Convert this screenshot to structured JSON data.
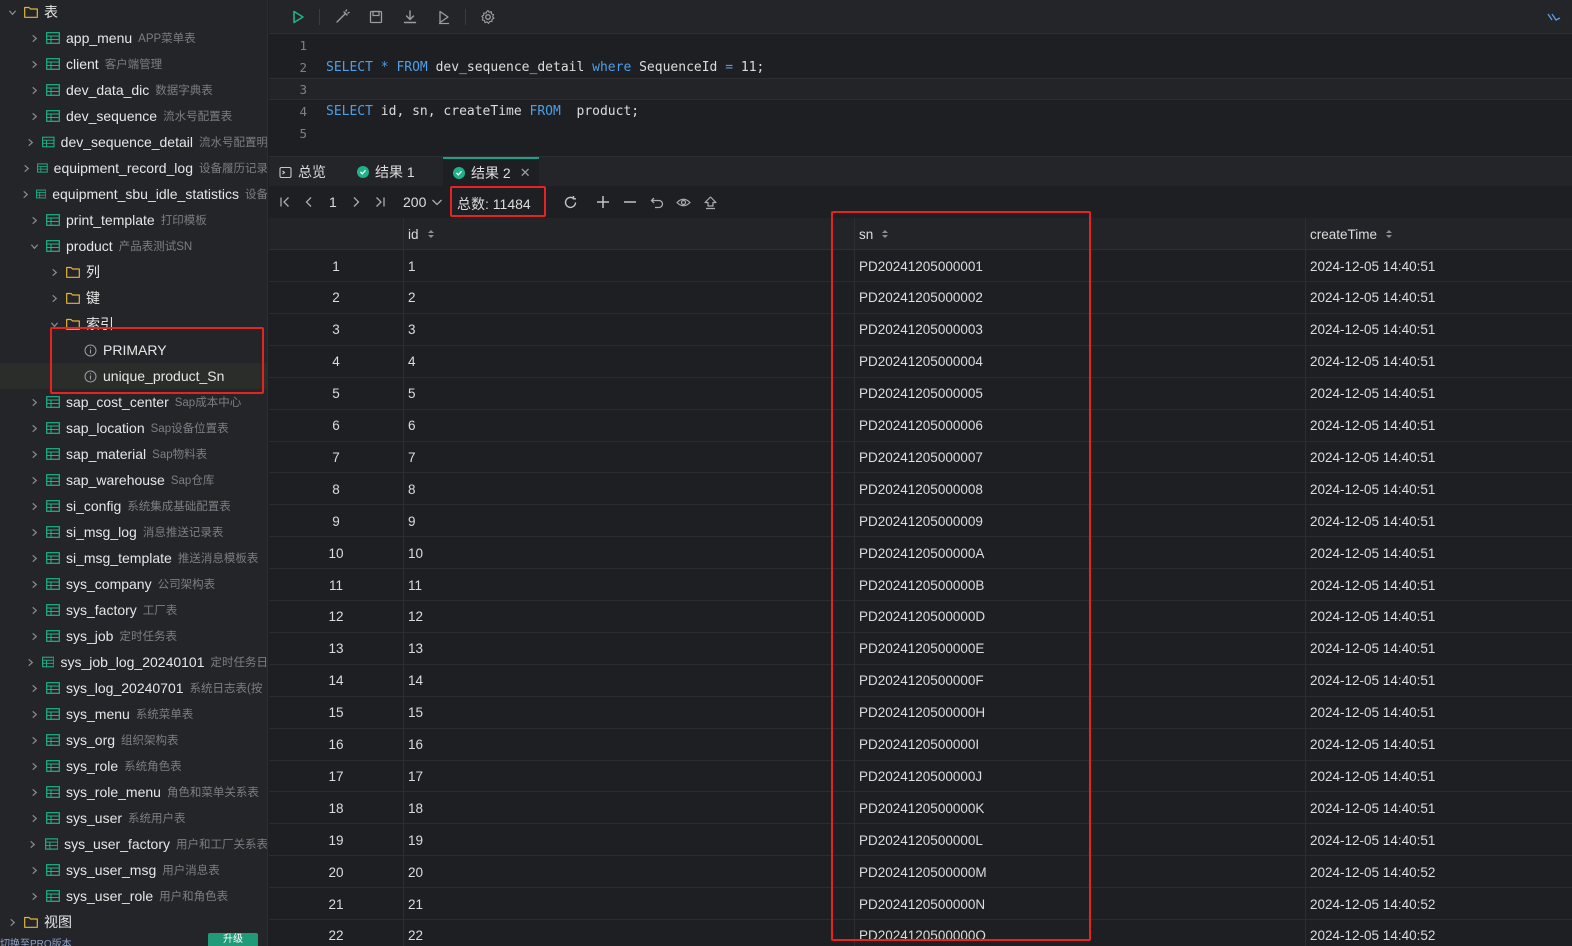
{
  "sidebar": {
    "root_label": "表",
    "tables": [
      {
        "name": "app_menu",
        "desc": "APP菜单表"
      },
      {
        "name": "client",
        "desc": "客户端管理"
      },
      {
        "name": "dev_data_dic",
        "desc": "数据字典表"
      },
      {
        "name": "dev_sequence",
        "desc": "流水号配置表"
      },
      {
        "name": "dev_sequence_detail",
        "desc": "流水号配置明"
      },
      {
        "name": "equipment_record_log",
        "desc": "设备履历记录"
      },
      {
        "name": "equipment_sbu_idle_statistics",
        "desc": "设备"
      },
      {
        "name": "print_template",
        "desc": "打印模板"
      },
      {
        "name": "product",
        "desc": "产品表测试SN"
      }
    ],
    "product_children": {
      "columns_label": "列",
      "keys_label": "键",
      "indexes_label": "索引",
      "indexes": [
        "PRIMARY",
        "unique_product_Sn"
      ]
    },
    "tables_after": [
      {
        "name": "sap_cost_center",
        "desc": "Sap成本中心"
      },
      {
        "name": "sap_location",
        "desc": "Sap设备位置表"
      },
      {
        "name": "sap_material",
        "desc": "Sap物料表"
      },
      {
        "name": "sap_warehouse",
        "desc": "Sap仓库"
      },
      {
        "name": "si_config",
        "desc": "系统集成基础配置表"
      },
      {
        "name": "si_msg_log",
        "desc": "消息推送记录表"
      },
      {
        "name": "si_msg_template",
        "desc": "推送消息模板表"
      },
      {
        "name": "sys_company",
        "desc": "公司架构表"
      },
      {
        "name": "sys_factory",
        "desc": "工厂表"
      },
      {
        "name": "sys_job",
        "desc": "定时任务表"
      },
      {
        "name": "sys_job_log_20240101",
        "desc": "定时任务日"
      },
      {
        "name": "sys_log_20240701",
        "desc": "系统日志表(按"
      },
      {
        "name": "sys_menu",
        "desc": "系统菜单表"
      },
      {
        "name": "sys_org",
        "desc": "组织架构表"
      },
      {
        "name": "sys_role",
        "desc": "系统角色表"
      },
      {
        "name": "sys_role_menu",
        "desc": "角色和菜单关系表"
      },
      {
        "name": "sys_user",
        "desc": "系统用户表"
      },
      {
        "name": "sys_user_factory",
        "desc": "用户和工厂关系表"
      },
      {
        "name": "sys_user_msg",
        "desc": "用户消息表"
      },
      {
        "name": "sys_user_role",
        "desc": "用户和角色表"
      }
    ],
    "views_label": "视图",
    "bottom_text": "切换至PRO版本",
    "bottom_button": "升级"
  },
  "editor": {
    "lines": [
      {
        "n": "1",
        "code": ""
      },
      {
        "n": "2",
        "code": "SELECT * FROM dev_sequence_detail where SequenceId = 11;"
      },
      {
        "n": "3",
        "code": ""
      },
      {
        "n": "4",
        "code": "SELECT id, sn, createTime FROM  product;"
      },
      {
        "n": "5",
        "code": ""
      }
    ]
  },
  "tabs": [
    {
      "label": "总览"
    },
    {
      "label": "结果 1"
    },
    {
      "label": "结果 2"
    }
  ],
  "pager": {
    "page": "1",
    "page_size": "200",
    "total_label": "总数:",
    "total_value": "11484"
  },
  "grid": {
    "columns": [
      "id",
      "sn",
      "createTime"
    ],
    "rows": [
      [
        "1",
        "1",
        "PD20241205000001",
        "2024-12-05 14:40:51"
      ],
      [
        "2",
        "2",
        "PD20241205000002",
        "2024-12-05 14:40:51"
      ],
      [
        "3",
        "3",
        "PD20241205000003",
        "2024-12-05 14:40:51"
      ],
      [
        "4",
        "4",
        "PD20241205000004",
        "2024-12-05 14:40:51"
      ],
      [
        "5",
        "5",
        "PD20241205000005",
        "2024-12-05 14:40:51"
      ],
      [
        "6",
        "6",
        "PD20241205000006",
        "2024-12-05 14:40:51"
      ],
      [
        "7",
        "7",
        "PD20241205000007",
        "2024-12-05 14:40:51"
      ],
      [
        "8",
        "8",
        "PD20241205000008",
        "2024-12-05 14:40:51"
      ],
      [
        "9",
        "9",
        "PD20241205000009",
        "2024-12-05 14:40:51"
      ],
      [
        "10",
        "10",
        "PD2024120500000A",
        "2024-12-05 14:40:51"
      ],
      [
        "11",
        "11",
        "PD2024120500000B",
        "2024-12-05 14:40:51"
      ],
      [
        "12",
        "12",
        "PD2024120500000D",
        "2024-12-05 14:40:51"
      ],
      [
        "13",
        "13",
        "PD2024120500000E",
        "2024-12-05 14:40:51"
      ],
      [
        "14",
        "14",
        "PD2024120500000F",
        "2024-12-05 14:40:51"
      ],
      [
        "15",
        "15",
        "PD2024120500000H",
        "2024-12-05 14:40:51"
      ],
      [
        "16",
        "16",
        "PD2024120500000I",
        "2024-12-05 14:40:51"
      ],
      [
        "17",
        "17",
        "PD2024120500000J",
        "2024-12-05 14:40:51"
      ],
      [
        "18",
        "18",
        "PD2024120500000K",
        "2024-12-05 14:40:51"
      ],
      [
        "19",
        "19",
        "PD2024120500000L",
        "2024-12-05 14:40:51"
      ],
      [
        "20",
        "20",
        "PD2024120500000M",
        "2024-12-05 14:40:52"
      ],
      [
        "21",
        "21",
        "PD2024120500000N",
        "2024-12-05 14:40:52"
      ],
      [
        "22",
        "22",
        "PD2024120500000O",
        "2024-12-05 14:40:52"
      ]
    ]
  },
  "colors": {
    "accent": "#17a38a",
    "highlight_box": "#e62222",
    "keyword": "#4e9ee8"
  }
}
